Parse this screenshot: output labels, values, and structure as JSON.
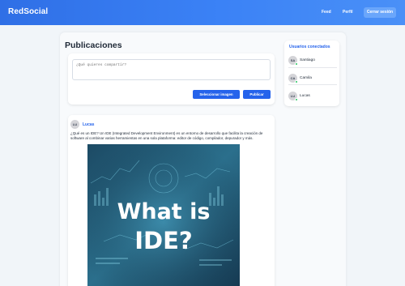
{
  "app": {
    "brand": "RedSocial"
  },
  "nav": {
    "feed": "Feed",
    "profile": "Perfil",
    "logout": "Cerrar sesión"
  },
  "page": {
    "title": "Publicaciones"
  },
  "composer": {
    "placeholder": "¿Qué quieres compartir?",
    "image_button": "Seleccionar imagen",
    "publish_button": "Publicar"
  },
  "post": {
    "author": "Lucas",
    "author_initials": "LU",
    "text": "¿Qué es un IDE? Un IDE (Integrated Development Environment) es un entorno de desarrollo que facilita la creación de software al combinar varias herramientas en una sola plataforma: editor de código, compilador, depurador y más.",
    "image_text_line1": "What is",
    "image_text_line2": "IDE?"
  },
  "sidebar": {
    "title": "Usuarios conectados",
    "users": [
      {
        "initials": "SA",
        "name": "Santiago",
        "online": true
      },
      {
        "initials": "CA",
        "name": "Camila",
        "online": true
      },
      {
        "initials": "LU",
        "name": "Lucas",
        "online": true
      }
    ]
  },
  "colors": {
    "accent": "#2563eb",
    "online": "#22c55e",
    "header": "#3b82f6"
  }
}
